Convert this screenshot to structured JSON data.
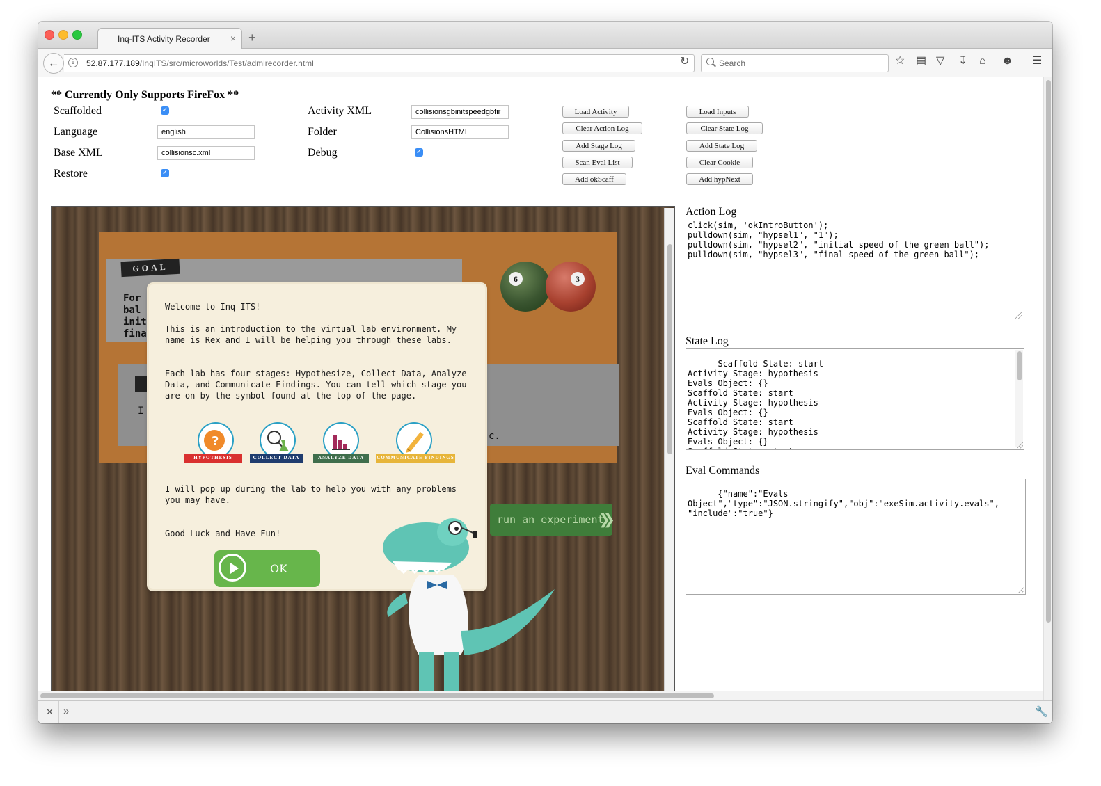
{
  "browser": {
    "tab_title": "Inq-ITS Activity Recorder",
    "tab_close": "×",
    "new_tab": "+",
    "url_host": "52.87.177.189",
    "url_path": "/InqITS/src/microworlds/Test/admlrecorder.html",
    "search_placeholder": "Search",
    "toolbar_icons": [
      "bookmark-star-icon",
      "reading-list-icon",
      "pocket-icon",
      "download-icon",
      "home-icon",
      "emoji-icon",
      "menu-icon"
    ]
  },
  "config": {
    "warning": "** Currently Only Supports FireFox **",
    "scaffolded_label": "Scaffolded",
    "scaffolded_checked": true,
    "language_label": "Language",
    "language_value": "english",
    "base_xml_label": "Base XML",
    "base_xml_value": "collisionsc.xml",
    "restore_label": "Restore",
    "restore_checked": true,
    "activity_xml_label": "Activity XML",
    "activity_xml_value": "collisionsgbinitspeedgbfir",
    "folder_label": "Folder",
    "folder_value": "CollisionsHTML",
    "debug_label": "Debug",
    "debug_checked": true
  },
  "buttons": {
    "col1": [
      "Load Activity",
      "Clear Action Log",
      "Add Stage Log",
      "Scan Eval List",
      "Add okScaff"
    ],
    "col2": [
      "Load Inputs",
      "Clear State Log",
      "Add State Log",
      "Clear Cookie",
      "Add hypNext"
    ]
  },
  "simulation": {
    "goal_label": "GOAL",
    "goal_fragment": "For\nbal\ninit\nfina",
    "fragment2": "I",
    "fragment3": "t",
    "fragment4": "c.",
    "ball_left": "6",
    "ball_right": "3",
    "run_button": "run an experiment",
    "dialog": {
      "welcome": "Welcome to Inq-ITS!",
      "intro": "This is an introduction to the virtual lab environment. My name is Rex and I will be helping you through these labs.",
      "stages_text": "Each lab has four stages: Hypothesize, Collect Data, Analyze Data, and Communicate Findings. You can tell which stage you are on by the symbol found at the top of the page.",
      "stages": [
        {
          "label": "HYPOTHESIS",
          "icon": "hypothesis-head-icon",
          "color": "#d9302f"
        },
        {
          "label": "COLLECT DATA",
          "icon": "magnifier-flask-icon",
          "color": "#1f3c6e"
        },
        {
          "label": "ANALYZE DATA",
          "icon": "bar-chart-icon",
          "color": "#3f6e4c"
        },
        {
          "label": "COMMUNICATE FINDINGS",
          "icon": "pencil-icon",
          "color": "#e7b53a"
        }
      ],
      "popup_text": "I will pop up during the lab to help you with any problems you may have.",
      "good_luck": "Good Luck and Have Fun!",
      "ok_label": "OK"
    }
  },
  "logs": {
    "action_label": "Action Log",
    "action_text": "click(sim, 'okIntroButton');\npulldown(sim, \"hypsel1\", \"1\");\npulldown(sim, \"hypsel2\", \"initial speed of the green ball\");\npulldown(sim, \"hypsel3\", \"final speed of the green ball\");",
    "state_label": "State Log",
    "state_text": "Scaffold State: start\nActivity Stage: hypothesis\nEvals Object: {}\nScaffold State: start\nActivity Stage: hypothesis\nEvals Object: {}\nScaffold State: start\nActivity Stage: hypothesis\nEvals Object: {}\nScaffold State: start\nActivity Stage: hypothesis",
    "eval_label": "Eval Commands",
    "eval_text": "{\"name\":\"Evals\nObject\",\"type\":\"JSON.stringify\",\"obj\":\"exeSim.activity.evals\",\n\"include\":\"true\"}"
  }
}
